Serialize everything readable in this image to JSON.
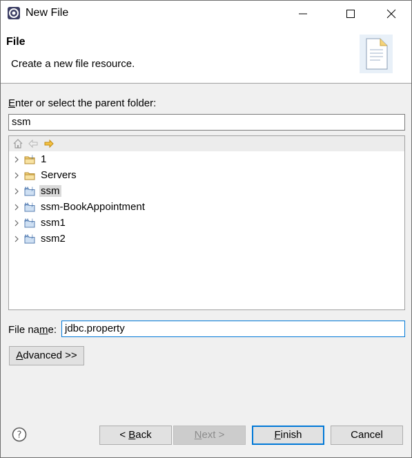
{
  "window": {
    "title": "New File",
    "icons": {
      "app": "eclipse-icon",
      "minimize": "minimize-icon",
      "maximize": "maximize-icon",
      "close": "close-icon"
    }
  },
  "banner": {
    "title": "File",
    "description": "Create a new file resource.",
    "image": "new-file-wizard-icon"
  },
  "parent_folder": {
    "label_pre": "",
    "label_mnemonic": "E",
    "label_post": "nter or select the parent folder:",
    "value": "ssm"
  },
  "tree": {
    "toolbar_icons": [
      "home-icon",
      "back-arrow-icon",
      "forward-arrow-icon"
    ],
    "items": [
      {
        "label": "1",
        "icon": "project-folder-icon",
        "selected": false
      },
      {
        "label": "Servers",
        "icon": "folder-icon",
        "selected": false
      },
      {
        "label": "ssm",
        "icon": "maven-project-icon",
        "selected": true
      },
      {
        "label": "ssm-BookAppointment",
        "icon": "maven-project-icon",
        "selected": false
      },
      {
        "label": "ssm1",
        "icon": "maven-project-icon",
        "selected": false
      },
      {
        "label": "ssm2",
        "icon": "maven-project-icon",
        "selected": false
      }
    ]
  },
  "file_name": {
    "label_pre": "File na",
    "label_mnemonic": "m",
    "label_post": "e:",
    "value": "jdbc.property"
  },
  "advanced_button": {
    "mnemonic": "A",
    "rest": "dvanced >>"
  },
  "footer": {
    "help_icon": "help-icon",
    "back": {
      "pre": "< ",
      "mnemonic": "B",
      "post": "ack"
    },
    "next": {
      "pre": "",
      "mnemonic": "N",
      "post": "ext >"
    },
    "finish": {
      "pre": "",
      "mnemonic": "F",
      "post": "inish"
    },
    "cancel": "Cancel"
  }
}
